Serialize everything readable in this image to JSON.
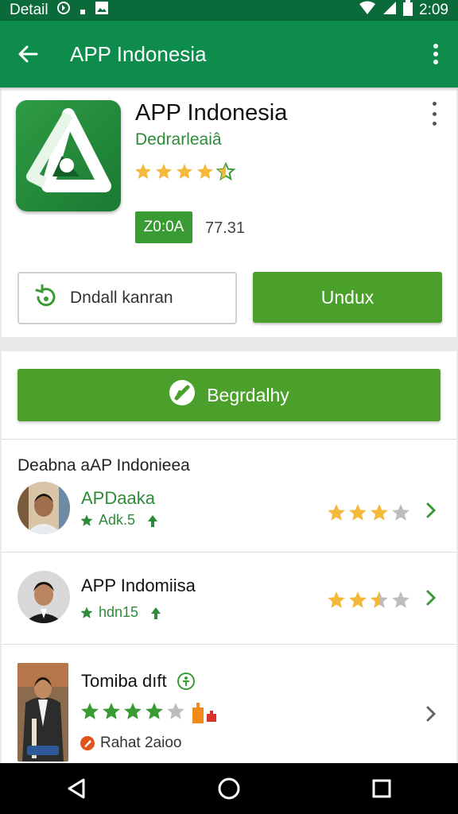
{
  "status_bar": {
    "left_label": "Detail",
    "time": "2:09",
    "icons": [
      "notification-icon",
      "dot-icon",
      "photo-icon",
      "wifi-icon",
      "signal-icon",
      "battery-icon"
    ]
  },
  "app_bar": {
    "title": "APP Indonesia",
    "icons": [
      "back-arrow-icon",
      "overflow-menu-icon"
    ]
  },
  "app_header": {
    "name": "APP Indonesia",
    "developer": "Dedrarleaiâ",
    "rating_stars": 4.5,
    "size_badge": "Z0:0A",
    "size_text": "77.31",
    "secondary_button_label": "Dndall kanran",
    "primary_button_label": "Undux"
  },
  "primary_action": {
    "label": "Begrdalhy"
  },
  "section": {
    "title": "Deabna aAP Indonieea"
  },
  "list": [
    {
      "name": "APDaaka",
      "meta": "Adk.5",
      "stars": 3,
      "name_color": "#2e8b3a"
    },
    {
      "name": "APP Indomiisa",
      "meta": "hdn15",
      "stars": 2.5,
      "name_color": "#111111"
    },
    {
      "name": "Tomiba dıft",
      "meta": "Rahat 2aioo",
      "stars": 4,
      "name_color": "#111111"
    }
  ],
  "colors": {
    "status_bar": "#0a6a3a",
    "app_bar": "#0d8c4c",
    "accent_green": "#4aa02b",
    "star_yellow": "#f4b93b",
    "star_gray": "#bdbdbd"
  },
  "nav_bar": {
    "icons": [
      "back-triangle-icon",
      "home-circle-icon",
      "recents-square-icon"
    ]
  }
}
